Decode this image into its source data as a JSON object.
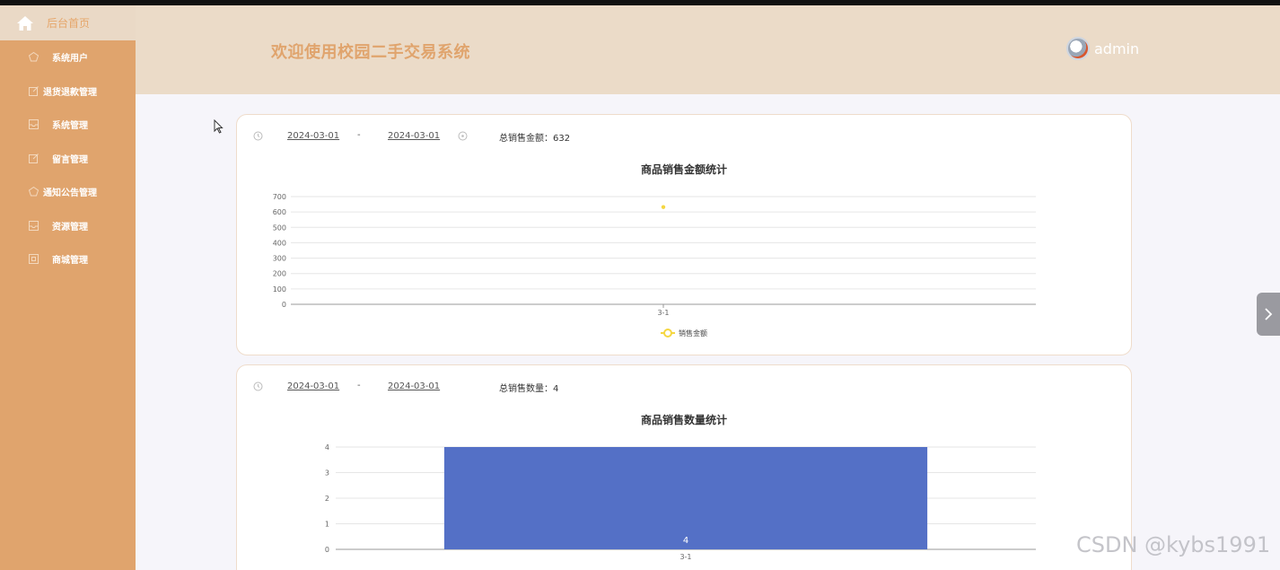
{
  "sidebar": {
    "home_label": "后台首页",
    "items": [
      {
        "label": "系统用户",
        "icon": "pentagon-icon"
      },
      {
        "label": "退货退款管理",
        "icon": "edit-icon"
      },
      {
        "label": "系统管理",
        "icon": "inbox-icon"
      },
      {
        "label": "留言管理",
        "icon": "edit-icon"
      },
      {
        "label": "通知公告管理",
        "icon": "pentagon-icon"
      },
      {
        "label": "资源管理",
        "icon": "inbox-icon"
      },
      {
        "label": "商城管理",
        "icon": "square-icon"
      }
    ]
  },
  "header": {
    "title": "欢迎使用校园二手交易系统",
    "username": "admin"
  },
  "card_amount": {
    "start_date": "2024-03-01",
    "separator": "-",
    "end_date": "2024-03-01",
    "stat_label": "总销售金额：632"
  },
  "card_quantity": {
    "start_date": "2024-03-01",
    "separator": "-",
    "end_date": "2024-03-01",
    "stat_label": "总销售数量：4"
  },
  "chart_data": [
    {
      "type": "line",
      "title": "商品销售金额统计",
      "categories": [
        "3-1"
      ],
      "series": [
        {
          "name": "销售金额",
          "values": [
            632
          ]
        }
      ],
      "yticks": [
        0,
        100,
        200,
        300,
        400,
        500,
        600,
        700
      ],
      "ylim": [
        0,
        700
      ],
      "grid": true,
      "legend": "bottom-center",
      "color": "#f5d742"
    },
    {
      "type": "bar",
      "title": "商品销售数量统计",
      "categories": [
        "3-1"
      ],
      "series": [
        {
          "values": [
            4
          ]
        }
      ],
      "yticks": [
        0,
        1,
        2,
        3,
        4
      ],
      "ylim": [
        0,
        4
      ],
      "grid": true,
      "data_labels": [
        "4"
      ],
      "color": "#5470c6"
    }
  ],
  "watermark": "CSDN @kybs1991",
  "colors": {
    "sidebar": "#e0a46d",
    "header": "#ebdbc8",
    "accent": "#e0a46d"
  }
}
